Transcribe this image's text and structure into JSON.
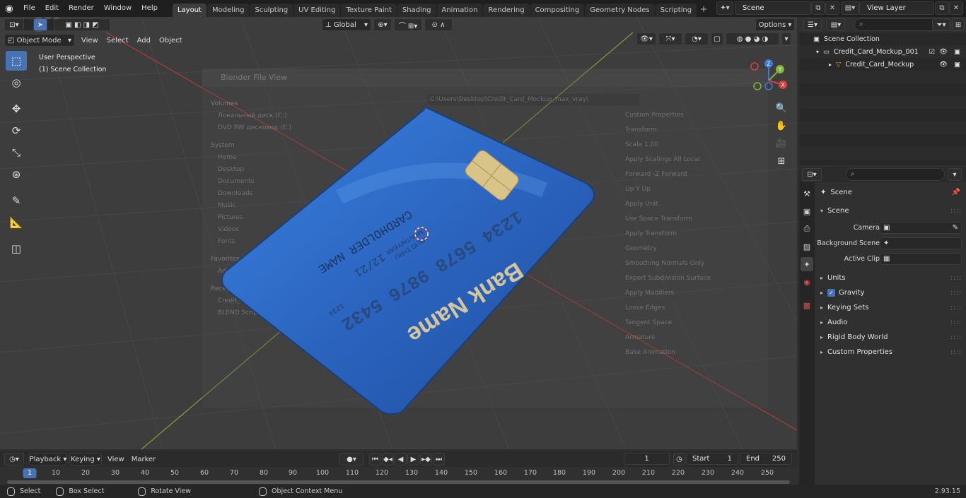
{
  "topbar": {
    "menus": [
      "File",
      "Edit",
      "Render",
      "Window",
      "Help"
    ],
    "workspaces": [
      "Layout",
      "Modeling",
      "Sculpting",
      "UV Editing",
      "Texture Paint",
      "Shading",
      "Animation",
      "Rendering",
      "Compositing",
      "Geometry Nodes",
      "Scripting"
    ],
    "active_workspace": "Layout",
    "add_tab": "+",
    "scene_name": "Scene",
    "view_layer": "View Layer"
  },
  "viewport": {
    "mode": "Object Mode",
    "menus": [
      "View",
      "Select",
      "Add",
      "Object"
    ],
    "transform_orientation": "Global",
    "options_label": "Options",
    "perspective_label": "User Perspective",
    "collection_label": "(1) Scene Collection",
    "gizmo_labels": {
      "z": "Z",
      "y": "Y",
      "x": "X"
    }
  },
  "ghost_dialog": {
    "title": "Blender File View",
    "sections": [
      {
        "header": "Volumes",
        "items": [
          "Локальный диск (C:)",
          "DVD RW дисковод (E:)"
        ]
      },
      {
        "header": "System",
        "items": [
          "Home",
          "Desktop",
          "Documents",
          "Downloads",
          "Music",
          "Pictures",
          "Videos",
          "Fonts"
        ]
      },
      {
        "header": "Favorites",
        "items": [
          "Add Bookmark"
        ]
      },
      {
        "header": "Recent",
        "items": [
          "Credit_Card_Mockup_max_vray",
          "BLEND Scripts"
        ]
      }
    ],
    "path": "C:\\Users\\Desktop\\Credit_Card_Mockup_max_vray\\",
    "options": [
      "Custom Properties",
      "Transform",
      "Scale 1.00",
      "Apply Scalings All Local",
      "Forward -Z Forward",
      "Up Y Up",
      "Apply Unit",
      "Use Space Transform",
      "Apply Transform",
      "Geometry",
      "Smoothing Normals Only",
      "Export Subdivision Surface",
      "Apply Modifiers",
      "Loose Edges",
      "Tangent Space",
      "Armature",
      "Bake Animation"
    ]
  },
  "card": {
    "bank_name": "Bank Name",
    "number": "1234  5678  9876  5432",
    "number_small": "1234",
    "holder": "CARDHOLDER NAME",
    "valid_label": "VALID THRU",
    "month_year": "MONTH/YEAR",
    "expiry": "12/21",
    "color": "#2f6fd0"
  },
  "timeline": {
    "menus": [
      "Playback",
      "Keying",
      "View",
      "Marker"
    ],
    "current_frame": "1",
    "start_label": "Start",
    "start": "1",
    "end_label": "End",
    "end": "250",
    "ticks": [
      "10",
      "20",
      "30",
      "40",
      "50",
      "60",
      "70",
      "80",
      "90",
      "100",
      "110",
      "120",
      "130",
      "140",
      "150",
      "160",
      "170",
      "180",
      "190",
      "200",
      "210",
      "220",
      "230",
      "240",
      "250"
    ]
  },
  "statusbar": {
    "items": [
      "Select",
      "Box Select",
      "Rotate View",
      "Object Context Menu"
    ],
    "version": "2.93.15"
  },
  "outliner": {
    "rows": [
      "Scene Collection",
      "Credit_Card_Mockup_001",
      "Credit_Card_Mockup"
    ]
  },
  "properties": {
    "context": "Scene",
    "panel_scene": "Scene",
    "fields": [
      {
        "label": "Camera",
        "value": ""
      },
      {
        "label": "Background Scene",
        "value": ""
      },
      {
        "label": "Active Clip",
        "value": ""
      }
    ],
    "panels": [
      "Units",
      "Gravity",
      "Keying Sets",
      "Audio",
      "Rigid Body World",
      "Custom Properties"
    ]
  }
}
